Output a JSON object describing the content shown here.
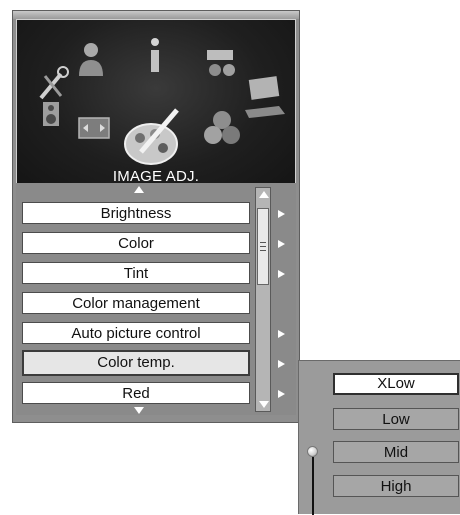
{
  "menu": {
    "title": "IMAGE ADJ.",
    "items": [
      {
        "label": "Brightness",
        "has_submenu": true
      },
      {
        "label": "Color",
        "has_submenu": true
      },
      {
        "label": "Tint",
        "has_submenu": true
      },
      {
        "label": "Color management",
        "has_submenu": false
      },
      {
        "label": "Auto picture control",
        "has_submenu": true
      },
      {
        "label": "Color temp.",
        "has_submenu": true,
        "selected": true
      },
      {
        "label": "Red",
        "has_submenu": true
      }
    ]
  },
  "submenu": {
    "options": [
      {
        "label": "XLow",
        "selected": true
      },
      {
        "label": "Low",
        "selected": false
      },
      {
        "label": "Mid",
        "selected": false
      },
      {
        "label": "High",
        "selected": false
      }
    ]
  },
  "icons": [
    "tools-icon",
    "person-icon",
    "info-icon",
    "projector-icon",
    "speaker-icon",
    "laptop-icon",
    "screen-adjust-icon",
    "palette-icon",
    "color-balls-icon"
  ],
  "colors": {
    "panel": "#8e8e8e",
    "icon_area": "#1f1f1f",
    "selected_item": "#e6e6e6"
  }
}
